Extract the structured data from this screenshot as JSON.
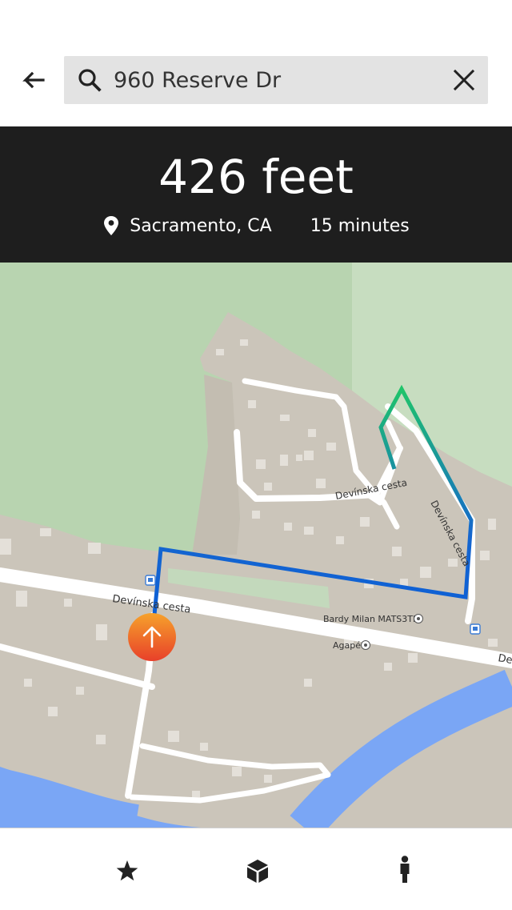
{
  "search": {
    "query": "960 Reserve Dr",
    "back_icon": "arrow-left-icon",
    "search_icon": "search-icon",
    "clear_icon": "close-icon"
  },
  "route_info": {
    "distance": "426 feet",
    "location": "Sacramento, CA",
    "duration": "15 minutes",
    "location_icon": "location-pin-icon",
    "background_color": "#1e1e1e"
  },
  "map": {
    "street_labels": [
      "Devínska cesta",
      "Devínska cesta",
      "Devínska cesta",
      "De"
    ],
    "places": [
      "Bardy Milan MATS3TH",
      "Agapé"
    ],
    "colors": {
      "vegetation": "#b8d4b0",
      "land": "#cbc5ba",
      "road": "#ffffff",
      "water": "#7aa6f5",
      "route_start": "#0d5fd6",
      "route_end": "#1fc46a"
    },
    "navigation_button": {
      "icon": "arrow-up-icon",
      "gradient": [
        "#f6a22b",
        "#e8402a"
      ]
    }
  },
  "bottom_nav": {
    "items": [
      {
        "name": "favorites",
        "icon": "star-icon"
      },
      {
        "name": "3d-view",
        "icon": "cube-icon"
      },
      {
        "name": "walking-mode",
        "icon": "person-icon"
      }
    ]
  }
}
